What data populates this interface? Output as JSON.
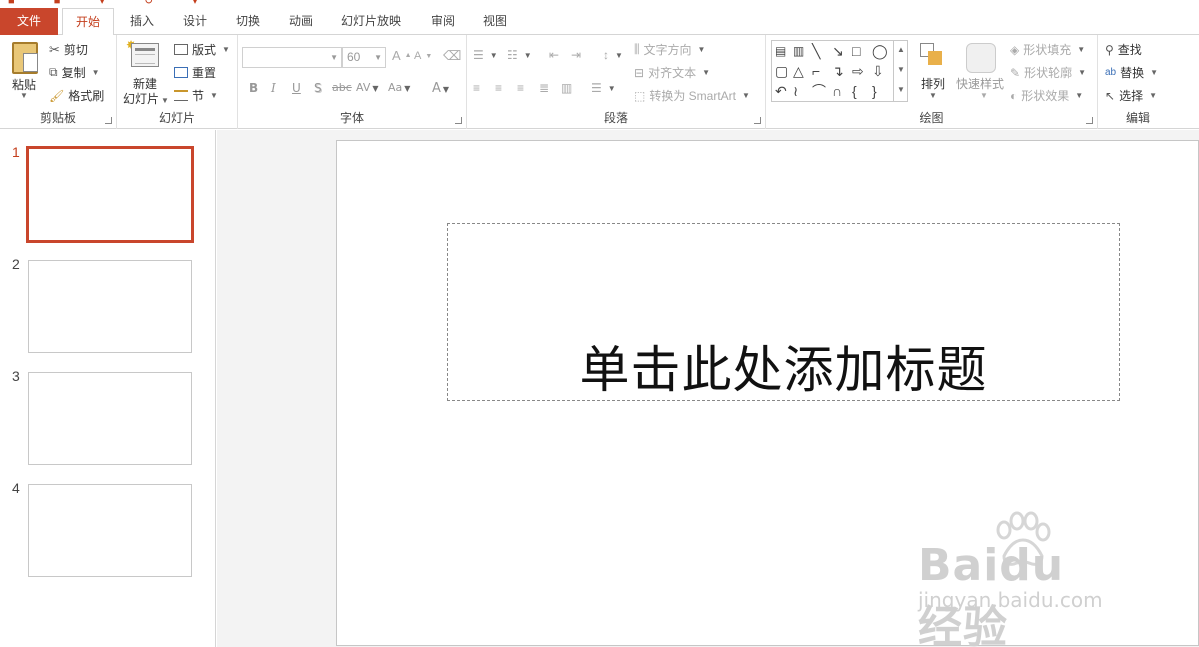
{
  "ribbon_tabs": {
    "file": "文件",
    "home": "开始",
    "insert": "插入",
    "design": "设计",
    "transitions": "切换",
    "animations": "动画",
    "slideshow": "幻灯片放映",
    "review": "审阅",
    "view": "视图"
  },
  "clipboard": {
    "paste": "粘贴",
    "cut": "剪切",
    "copy": "复制",
    "format_painter": "格式刷",
    "label": "剪贴板"
  },
  "slides": {
    "new_slide_line1": "新建",
    "new_slide_line2": "幻灯片",
    "layout": "版式",
    "reset": "重置",
    "section": "节",
    "label": "幻灯片"
  },
  "font": {
    "name_value": "",
    "size_value": "60",
    "bold": "B",
    "italic": "I",
    "underline": "U",
    "shadow": "S",
    "strikethrough": "abc",
    "spacing": "AV",
    "case": "Aa",
    "color": "A",
    "grow": "A",
    "shrink": "A",
    "label": "字体"
  },
  "paragraph": {
    "text_direction": "文字方向",
    "align_text": "对齐文本",
    "convert_smartart": "转换为 SmartArt",
    "label": "段落"
  },
  "drawing": {
    "arrange": "排列",
    "quick_styles": "快速样式",
    "shape_fill": "形状填充",
    "shape_outline": "形状轮廓",
    "shape_effects": "形状效果",
    "label": "绘图"
  },
  "editing": {
    "find": "查找",
    "replace": "替换",
    "select": "选择",
    "label": "编辑"
  },
  "thumbnails": [
    {
      "number": "1"
    },
    {
      "number": "2"
    },
    {
      "number": "3"
    },
    {
      "number": "4"
    }
  ],
  "slide": {
    "title_placeholder": "单击此处添加标题"
  },
  "watermark": {
    "brand": "Baidu经验",
    "url": "jingyan.baidu.com"
  },
  "colors": {
    "accent": "#c43e1c",
    "file_tab": "#c9462c"
  }
}
